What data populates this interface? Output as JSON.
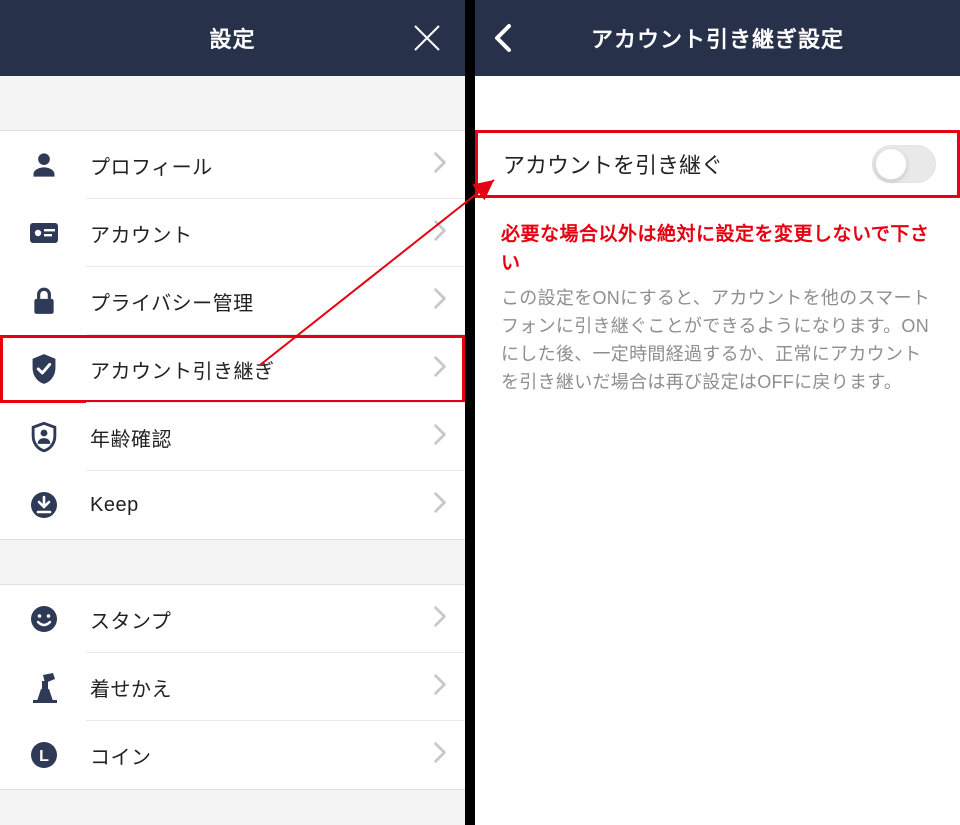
{
  "left": {
    "title": "設定",
    "group1": [
      {
        "label": "プロフィール",
        "icon": "profile-icon",
        "hl": false
      },
      {
        "label": "アカウント",
        "icon": "account-icon",
        "hl": false
      },
      {
        "label": "プライバシー管理",
        "icon": "privacy-icon",
        "hl": false
      },
      {
        "label": "アカウント引き継ぎ",
        "icon": "transfer-icon",
        "hl": true
      },
      {
        "label": "年齢確認",
        "icon": "age-icon",
        "hl": false
      },
      {
        "label": "Keep",
        "icon": "keep-icon",
        "hl": false
      }
    ],
    "group2": [
      {
        "label": "スタンプ",
        "icon": "stamp-icon"
      },
      {
        "label": "着せかえ",
        "icon": "theme-icon"
      },
      {
        "label": "コイン",
        "icon": "coin-icon"
      }
    ]
  },
  "right": {
    "title": "アカウント引き継ぎ設定",
    "toggle_label": "アカウントを引き継ぐ",
    "toggle_on": false,
    "warning": "必要な場合以外は絶対に設定を変更しないで下さい",
    "description": "この設定をONにすると、アカウントを他のスマートフォンに引き継ぐことができるようになります。ONにした後、一定時間経過するか、正常にアカウントを引き継いだ場合は再び設定はOFFに戻ります。"
  },
  "annotation": {
    "highlight_color": "#e60012"
  }
}
